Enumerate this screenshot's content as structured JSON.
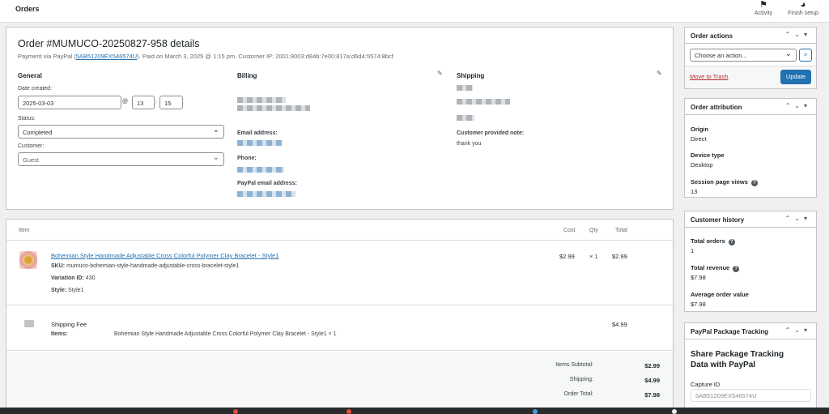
{
  "header": {
    "title": "Orders",
    "activity": "Activity",
    "finish_setup": "Finish setup"
  },
  "order": {
    "title": "Order #MUMUCO-20250827-958 details",
    "payment_prefix": "Payment via PayPal (",
    "transaction_id": "5AB51209EX546574U",
    "payment_suffix": "). Paid on March 3, 2025 @ 1:15 pm. Customer IP: 2001:8003:d84b:7e00:817a:d6d4:5574:8bcf"
  },
  "general": {
    "heading": "General",
    "date_label": "Date created:",
    "date_value": "2025-03-03",
    "at": "@",
    "hour": "13",
    "colon": ":",
    "minute": "15",
    "status_label": "Status:",
    "status_value": "Completed",
    "customer_label": "Customer:",
    "customer_value": "Guest"
  },
  "billing": {
    "heading": "Billing",
    "email_label": "Email address:",
    "phone_label": "Phone:",
    "paypal_email_label": "PayPal email address:"
  },
  "shipping": {
    "heading": "Shipping",
    "note_label": "Customer provided note:",
    "note_value": "thank you"
  },
  "items": {
    "col_item": "Item",
    "col_cost": "Cost",
    "col_qty": "Qty",
    "col_total": "Total",
    "rows": [
      {
        "name": "Bohemian Style Handmade Adjustable Cross Colorful Polymer Clay Bracelet - Style1",
        "sku_label": "SKU:",
        "sku": "mumuco-bohemian-style-handmade-adjustable-cross-bracelet-style1",
        "variation_label": "Variation ID:",
        "variation_id": "430",
        "style_label": "Style:",
        "style": "Style1",
        "cost": "$2.99",
        "qty": "× 1",
        "total": "$2.99"
      }
    ],
    "shipping": {
      "name": "Shipping Fee",
      "items_label": "Items:",
      "items_value": "Bohemian Style Handmade Adjustable Cross Colorful Polymer Clay Bracelet - Style1 × 1",
      "total": "$4.99"
    },
    "totals": [
      {
        "label": "Items Subtotal:",
        "value": "$2.99"
      },
      {
        "label": "Shipping:",
        "value": "$4.99"
      },
      {
        "label": "Order Total:",
        "value": "$7.98"
      }
    ]
  },
  "order_actions": {
    "title": "Order actions",
    "select": "Choose an action...",
    "go": ">",
    "trash": "Move to Trash",
    "update": "Update"
  },
  "attribution": {
    "title": "Order attribution",
    "origin_label": "Origin",
    "origin": "Direct",
    "device_label": "Device type",
    "device": "Desktop",
    "views_label": "Session page views",
    "views": "13"
  },
  "history": {
    "title": "Customer history",
    "orders_label": "Total orders",
    "orders": "1",
    "revenue_label": "Total revenue",
    "revenue": "$7.98",
    "aov_label": "Average order value",
    "aov": "$7.98"
  },
  "paypal": {
    "title": "PayPal Package Tracking",
    "heading": "Share Package Tracking Data with PayPal",
    "capture_label": "Capture ID",
    "capture_value": "5AB51209EX546574U"
  },
  "colors": {
    "accent": "#2271b1",
    "danger": "#b32d2e"
  }
}
